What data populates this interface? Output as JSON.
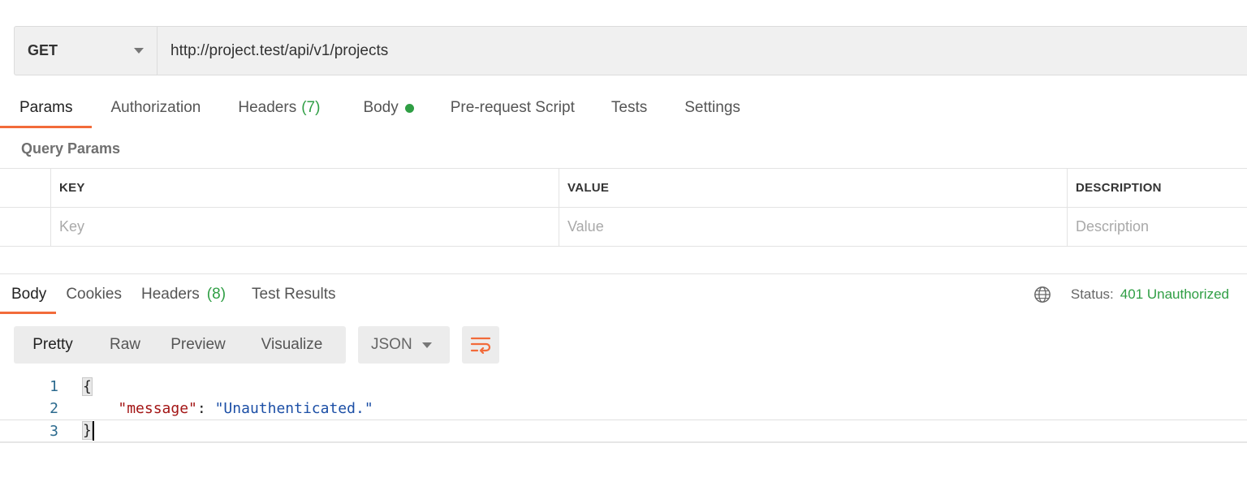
{
  "request": {
    "method": "GET",
    "url": "http://project.test/api/v1/projects"
  },
  "request_tabs": [
    {
      "label": "Params",
      "active": true
    },
    {
      "label": "Authorization"
    },
    {
      "label": "Headers",
      "count": "(7)"
    },
    {
      "label": "Body",
      "indicator": "green-dot"
    },
    {
      "label": "Pre-request Script"
    },
    {
      "label": "Tests"
    },
    {
      "label": "Settings"
    }
  ],
  "query_params": {
    "title": "Query Params",
    "columns": [
      "KEY",
      "VALUE",
      "DESCRIPTION"
    ],
    "placeholders": [
      "Key",
      "Value",
      "Description"
    ]
  },
  "response_tabs": [
    {
      "label": "Body",
      "active": true
    },
    {
      "label": "Cookies"
    },
    {
      "label": "Headers",
      "count": "(8)"
    },
    {
      "label": "Test Results"
    }
  ],
  "status": {
    "label": "Status:",
    "value": "401 Unauthorized",
    "icon": "globe-icon",
    "color": "#2f9e44"
  },
  "format_buttons": [
    "Pretty",
    "Raw",
    "Preview",
    "Visualize"
  ],
  "format_active": "Pretty",
  "language": "JSON",
  "wrap_icon": "wrap-lines-icon",
  "code": {
    "line_numbers": [
      "1",
      "2",
      "3"
    ],
    "open_brace": "{",
    "key": "\"message\"",
    "colon": ": ",
    "value": "\"Unauthenticated.\"",
    "close_brace": "}"
  },
  "colors": {
    "accent": "#f26b3a",
    "success": "#2f9e44"
  }
}
